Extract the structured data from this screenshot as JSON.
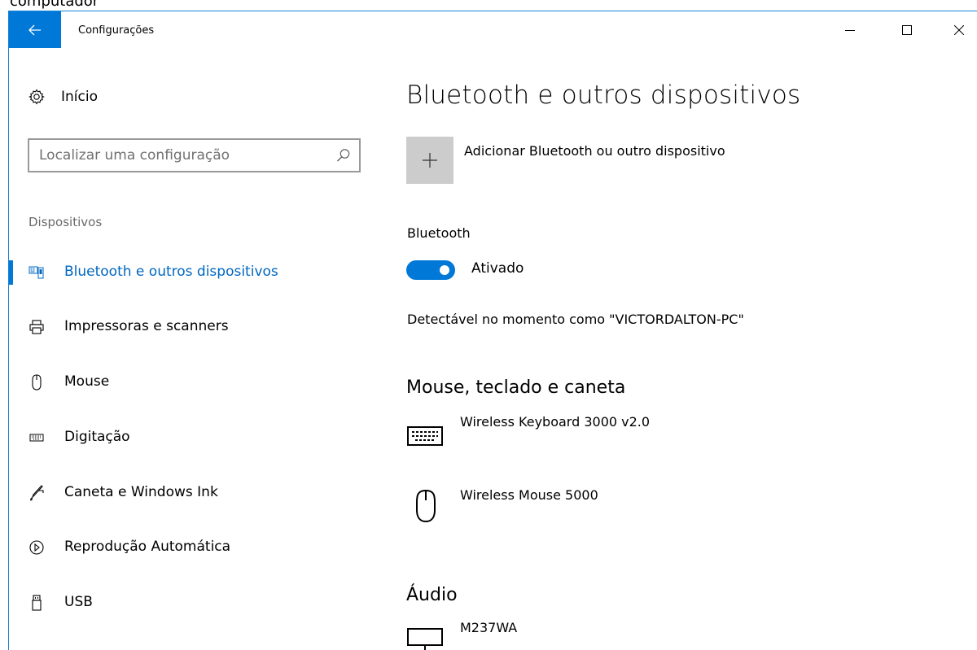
{
  "background_text": "computador",
  "window": {
    "title": "Configurações",
    "back_icon": "arrow-left-icon",
    "controls": [
      "minimize-icon",
      "maximize-icon",
      "close-icon"
    ]
  },
  "sidebar": {
    "home_label": "Início",
    "search_placeholder": "Localizar uma configuração",
    "section_label": "Dispositivos",
    "items": [
      {
        "label": "Bluetooth e outros dispositivos",
        "icon": "bluetooth-devices-icon",
        "active": true
      },
      {
        "label": "Impressoras e scanners",
        "icon": "printer-icon",
        "active": false
      },
      {
        "label": "Mouse",
        "icon": "mouse-icon",
        "active": false
      },
      {
        "label": "Digitação",
        "icon": "keyboard-icon",
        "active": false
      },
      {
        "label": "Caneta e Windows Ink",
        "icon": "pen-icon",
        "active": false
      },
      {
        "label": "Reprodução Automática",
        "icon": "autoplay-icon",
        "active": false
      },
      {
        "label": "USB",
        "icon": "usb-icon",
        "active": false
      }
    ]
  },
  "main": {
    "title": "Bluetooth e outros dispositivos",
    "add_device_label": "Adicionar Bluetooth ou outro dispositivo",
    "bluetooth_label": "Bluetooth",
    "toggle_state": "Ativado",
    "discoverable_text": "Detectável no momento como \"VICTORDALTON-PC\"",
    "section_input": "Mouse, teclado e caneta",
    "input_devices": [
      {
        "name": "Wireless Keyboard 3000 v2.0",
        "icon": "keyboard-icon"
      },
      {
        "name": "Wireless Mouse 5000",
        "icon": "mouse-icon"
      }
    ],
    "section_audio": "Áudio",
    "audio_devices": [
      {
        "name": "M237WA",
        "icon": "monitor-icon"
      }
    ]
  },
  "colors": {
    "accent": "#0078d7",
    "active_text": "#0067c0"
  }
}
